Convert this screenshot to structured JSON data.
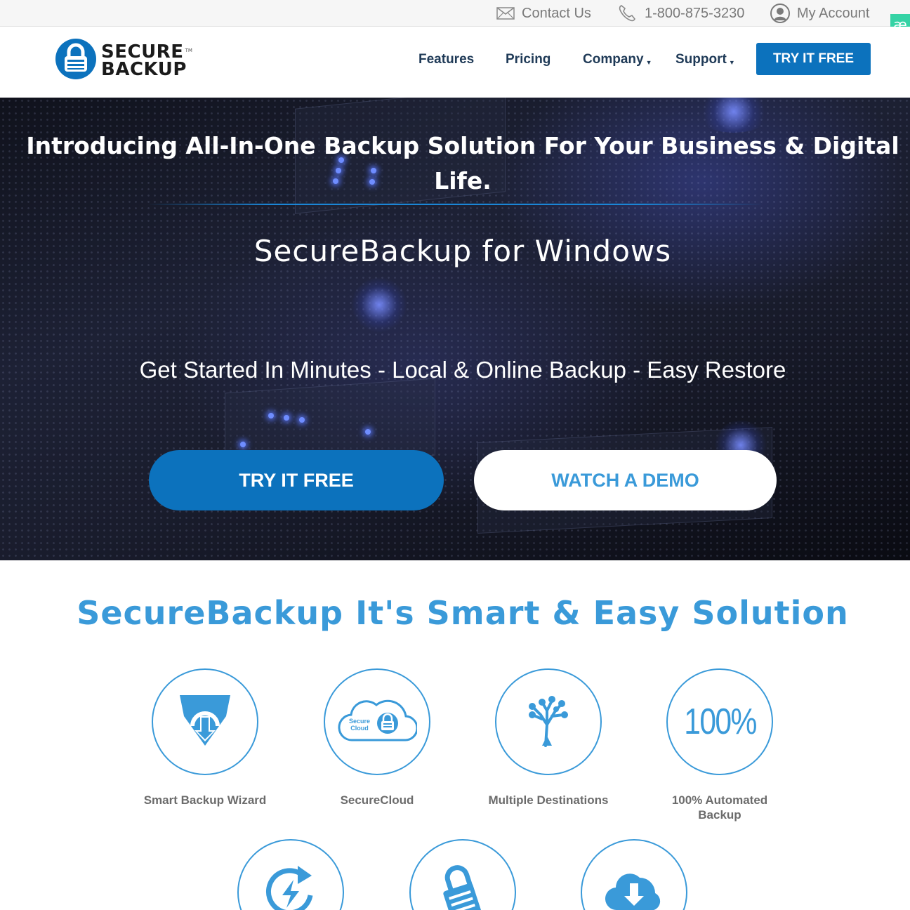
{
  "topbar": {
    "contact_label": "Contact Us",
    "phone": "1-800-875-3230",
    "account_label": "My Account",
    "extension_badge": "æ"
  },
  "logo": {
    "line1": "SECURE",
    "line2": "BACKUP",
    "trademark": "TM"
  },
  "nav": {
    "features": "Features",
    "pricing": "Pricing",
    "company": "Company",
    "support": "Support",
    "cta": "TRY IT FREE"
  },
  "hero": {
    "title": "Introducing All-In-One Backup Solution For Your Business & Digital Life.",
    "subtitle": "SecureBackup for Windows",
    "tagline": "Get Started In Minutes - Local & Online Backup - Easy Restore",
    "try_button": "TRY IT FREE",
    "demo_button": "WATCH A DEMO"
  },
  "features": {
    "title": "SecureBackup It's Smart & Easy Solution",
    "items": [
      {
        "label": "Smart Backup Wizard",
        "icon": "shield-download-icon"
      },
      {
        "label": "SecureCloud",
        "icon": "secure-cloud-icon",
        "icon_text_1": "Secure",
        "icon_text_2": "Cloud"
      },
      {
        "label": "Multiple Destinations",
        "icon": "tree-network-icon"
      },
      {
        "label": "100% Automated Backup",
        "icon": "hundred-percent-icon",
        "icon_text": "100%"
      },
      {
        "label": "",
        "icon": "refresh-bolt-icon"
      },
      {
        "label": "",
        "icon": "padlock-icon"
      },
      {
        "label": "",
        "icon": "cloud-download-icon"
      }
    ]
  },
  "colors": {
    "brand_blue": "#0c72bd",
    "accent_blue": "#3a9ad9",
    "nav_text": "#1f3a57",
    "extension_green": "#35d3a5"
  }
}
